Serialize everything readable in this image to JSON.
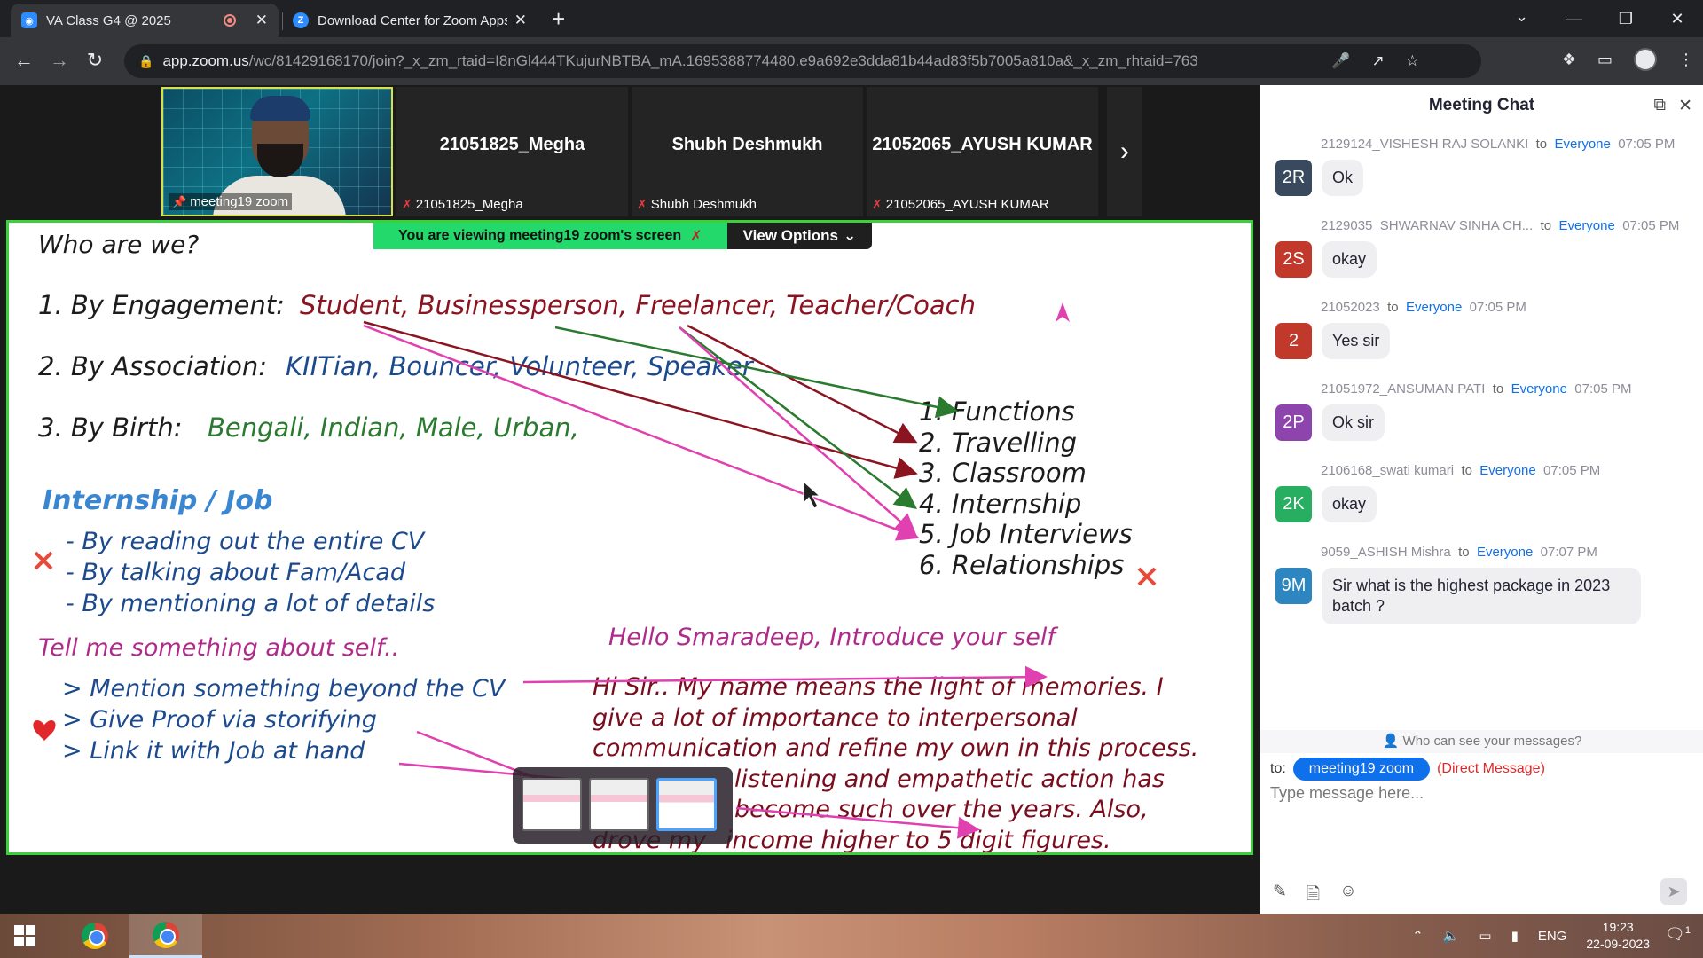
{
  "browser": {
    "tabs": [
      {
        "title": "VA Class G4 @ 2025",
        "fav": "zoom-camera-icon",
        "recording": true
      },
      {
        "title": "Download Center for Zoom Apps",
        "fav": "Z"
      }
    ],
    "url_host": "app.zoom.us",
    "url_path": "/wc/81429168170/join?_x_zm_rtaid=I8nGl444TKujurNBTBA_mA.1695388774480.e9a692e3dda81b44ad83f5b7005a810a&_x_zm_rhtaid=763"
  },
  "meeting": {
    "participants": [
      {
        "name": "meeting19 zoom",
        "video": true
      },
      {
        "name": "21051825_Megha",
        "big": "21051825_Megha"
      },
      {
        "name": "Shubh Deshmukh",
        "big": "Shubh Deshmukh"
      },
      {
        "name": "21052065_AYUSH KUMAR",
        "big": "21052065_AYUSH KUMAR"
      }
    ],
    "banner_text": "You are viewing  meeting19 zoom's screen",
    "view_options": "View Options"
  },
  "slide": {
    "title": "Who are we?",
    "line1_label": "1. By Engagement:",
    "line1_value": "Student, Businessperson, Freelancer, Teacher/Coach",
    "line2_label": "2. By Association:",
    "line2_value": "KIITian, Bouncer, Volunteer, Speaker",
    "line3_label": "3. By Birth:",
    "line3_value": "Bengali, Indian, Male, Urban,",
    "list": [
      "1. Functions",
      "2. Travelling",
      "3. Classroom",
      "4. Internship",
      "5. Job Interviews",
      "6. Relationships"
    ],
    "internship_heading": "Internship / Job",
    "internship_items": [
      "- By reading out the entire CV",
      "- By talking about Fam/Acad",
      "- By mentioning a lot of details"
    ],
    "tell_heading": "Tell me something about self..",
    "tell_items": [
      "> Mention something beyond the CV",
      "> Give Proof via storifying",
      "> Link it with Job at hand"
    ],
    "hello_line": "Hello Smaradeep, Introduce your self",
    "answer_lines": [
      "Hi Sir.. My name means the light of memories. I",
      "give a lot of importance to interpersonal",
      "communication and refine my own in this process.",
      "listening and empathetic action has",
      "become such over the years. Also,",
      "income higher to 5 digit figures."
    ],
    "answer_partial_prefix": "drove my"
  },
  "chat": {
    "title": "Meeting Chat",
    "to_word": "to",
    "messages": [
      {
        "sender": "2129124_VISHESH RAJ SOLANKI",
        "to": "Everyone",
        "time": "07:05 PM",
        "initials": "2R",
        "color": "#3a4a5e",
        "text": "Ok"
      },
      {
        "sender": "2129035_SHWARNAV SINHA CH...",
        "to": "Everyone",
        "time": "07:05 PM",
        "initials": "2S",
        "color": "#c0392b",
        "text": "okay"
      },
      {
        "sender": "21052023",
        "to": "Everyone",
        "time": "07:05 PM",
        "initials": "2",
        "color": "#c0392b",
        "text": "Yes sir"
      },
      {
        "sender": "21051972_ANSUMAN PATI",
        "to": "Everyone",
        "time": "07:05 PM",
        "initials": "2P",
        "color": "#8e44ad",
        "text": "Ok sir"
      },
      {
        "sender": "2106168_swati kumari",
        "to": "Everyone",
        "time": "07:05 PM",
        "initials": "2K",
        "color": "#27ae60",
        "text": "okay"
      },
      {
        "sender": "9059_ASHISH Mishra",
        "to": "Everyone",
        "time": "07:07 PM",
        "initials": "9M",
        "color": "#2e86c1",
        "text": "Sir what is the highest package in 2023 batch ?"
      }
    ],
    "who_can_see": "Who can see your messages?",
    "to_label": "to:",
    "recipient": "meeting19 zoom",
    "direct_message": "(Direct Message)",
    "placeholder": "Type message here..."
  },
  "taskbar": {
    "language": "ENG",
    "time": "19:23",
    "date": "22-09-2023",
    "notifications": "1"
  }
}
